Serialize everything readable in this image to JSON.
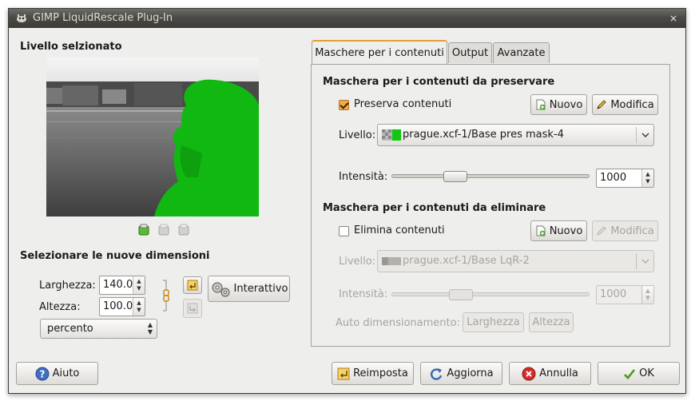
{
  "window": {
    "title": "GIMP LiquidRescale Plug-In",
    "close_glyph": "×"
  },
  "left": {
    "selected_layer_heading": "Livello selzionato",
    "new_size_heading": "Selezionare le nuove dimensioni",
    "width_label": "Larghezza:",
    "width_value": "140.00",
    "height_label": "Altezza:",
    "height_value": "100.00",
    "unit_value": "percento",
    "interactive_button": "Interattivo"
  },
  "tabs": [
    {
      "label": "Maschere per i contenuti"
    },
    {
      "label": "Output"
    },
    {
      "label": "Avanzate"
    }
  ],
  "preserve": {
    "heading": "Maschera per i contenuti da preservare",
    "checkbox_label": "Preserva contenuti",
    "checked": true,
    "new_button": "Nuovo",
    "edit_button": "Modifica",
    "layer_label": "Livello:",
    "layer_value": "prague.xcf-1/Base pres mask-4",
    "intensity_label": "Intensità:",
    "intensity_value": "1000",
    "slider_fraction": 0.3
  },
  "discard": {
    "heading": "Maschera per i contenuti da eliminare",
    "checkbox_label": "Elimina contenuti",
    "checked": false,
    "new_button": "Nuovo",
    "edit_button": "Modifica",
    "layer_label": "Livello:",
    "layer_value": "prague.xcf-1/Base LqR-2",
    "intensity_label": "Intensità:",
    "intensity_value": "1000",
    "auto_label": "Auto dimensionamento:",
    "auto_width_button": "Larghezza",
    "auto_height_button": "Altezza"
  },
  "footer": {
    "help": "Aiuto",
    "reset": "Reimposta",
    "refresh": "Aggiorna",
    "cancel": "Annulla",
    "ok": "OK"
  },
  "colors": {
    "mask_green": "#11b811",
    "tab_accent": "#e89c3a",
    "title_bar": "#3c3b37"
  }
}
